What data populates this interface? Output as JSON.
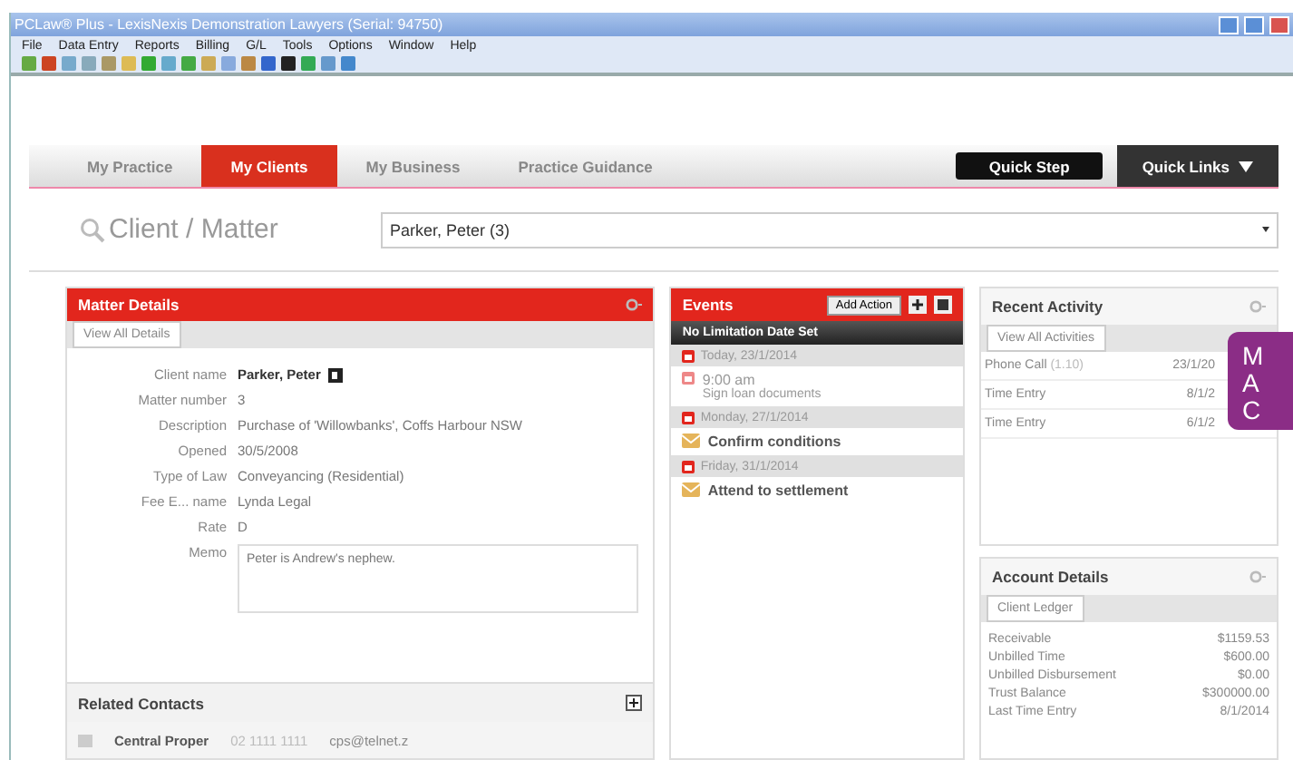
{
  "window": {
    "title": "PCLaw® Plus - LexisNexis Demonstration Lawyers (Serial: 94750)"
  },
  "menu": [
    "File",
    "Data Entry",
    "Reports",
    "Billing",
    "G/L",
    "Tools",
    "Options",
    "Window",
    "Help"
  ],
  "tabs": [
    {
      "label": "My Practice",
      "selected": false
    },
    {
      "label": "My Clients",
      "selected": true
    },
    {
      "label": "My Business",
      "selected": false
    },
    {
      "label": "Practice Guidance",
      "selected": false
    }
  ],
  "quick_step": "Quick Step",
  "quick_links": "Quick Links",
  "search": {
    "label": "Client / Matter",
    "value": "Parker, Peter (3)"
  },
  "matter_details": {
    "title": "Matter Details",
    "subtab": "View All Details",
    "fields": [
      {
        "label": "Client name",
        "value": "Parker, Peter",
        "kind": "name"
      },
      {
        "label": "Matter number",
        "value": "3",
        "kind": "text"
      },
      {
        "label": "Description",
        "value": "Purchase of 'Willowbanks', Coffs Harbour NSW",
        "kind": "text"
      },
      {
        "label": "Opened",
        "value": "30/5/2008",
        "kind": "text"
      },
      {
        "label": "Type of Law",
        "value": "Conveyancing (Residential)",
        "kind": "text"
      },
      {
        "label": "Fee E... name",
        "value": "Lynda Legal",
        "kind": "text"
      },
      {
        "label": "Rate",
        "value": "D",
        "kind": "text"
      }
    ],
    "memo_label": "Memo",
    "memo": "Peter is Andrew's nephew."
  },
  "related_contacts": {
    "title": "Related Contacts",
    "rows": [
      {
        "name": "Central Proper",
        "phone": "02 1111 1111",
        "email": "cps@telnet.z"
      }
    ]
  },
  "events": {
    "title": "Events",
    "add_action": "Add Action",
    "limitation": "No Limitation Date Set",
    "days": [
      {
        "date": "Today, 23/1/2014",
        "items": [
          {
            "kind": "appointment",
            "time": "9:00 am",
            "text": "Sign loan documents"
          }
        ]
      },
      {
        "date": "Monday, 27/1/2014",
        "items": [
          {
            "kind": "task",
            "text": "Confirm conditions"
          }
        ]
      },
      {
        "date": "Friday, 31/1/2014",
        "items": [
          {
            "kind": "task",
            "text": "Attend to settlement"
          }
        ]
      }
    ]
  },
  "recent_activity": {
    "title": "Recent Activity",
    "subtab": "View All Activities",
    "rows": [
      {
        "type": "Phone Call",
        "detail": "(1.10)",
        "date": "23/1/20"
      },
      {
        "type": "Time Entry",
        "date": "8/1/2"
      },
      {
        "type": "Time Entry",
        "date": "6/1/2"
      }
    ]
  },
  "account_details": {
    "title": "Account Details",
    "subtab": "Client Ledger",
    "rows": [
      {
        "label": "Receivable",
        "value": "$1159.53"
      },
      {
        "label": "Unbilled Time",
        "value": "$600.00"
      },
      {
        "label": "Unbilled Disbursement",
        "value": "$0.00"
      },
      {
        "label": "Trust Balance",
        "value": "$300000.00"
      },
      {
        "label": "Last Time Entry",
        "value": "8/1/2014"
      }
    ]
  },
  "callout": {
    "lines": [
      "M",
      "A",
      "C"
    ]
  }
}
